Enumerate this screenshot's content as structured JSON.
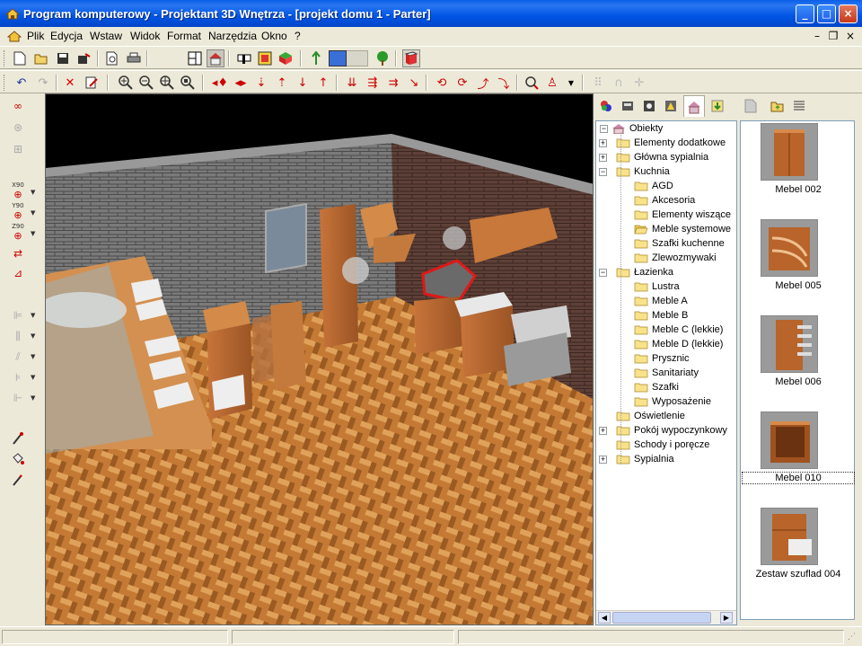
{
  "window": {
    "title": "Program komputerowy - Projektant 3D Wnętrza - [projekt domu 1 - Parter]",
    "controls": {
      "minimize": "_",
      "maximize": "□",
      "close": "×"
    }
  },
  "menu": {
    "items": [
      "Plik",
      "Edycja",
      "Wstaw",
      "Widok",
      "Format",
      "Narzędzia",
      "Okno",
      "?"
    ],
    "mdi_controls": [
      "–",
      "❐",
      "×"
    ]
  },
  "toolbar1": {
    "icons": [
      "new-icon",
      "open-icon",
      "save-icon",
      "save-as-icon",
      "print-preview-icon",
      "print-icon",
      "plan-view-icon",
      "3d-house-icon",
      "wall-view-icon",
      "object-view-icon",
      "3d-cube-icon",
      "arrow-icon",
      "color-swatch",
      "tree-icon",
      "book-icon"
    ],
    "color_swatch": "#3a6fd8"
  },
  "toolbar2": {
    "icons": [
      "undo-icon",
      "redo-icon",
      "delete-icon",
      "properties-icon",
      "zoom-in-icon",
      "zoom-out-icon",
      "zoom-all-icon",
      "zoom-fit-icon",
      "move-left-right-icon",
      "move-both-icon",
      "move-down-icon",
      "move-up-icon",
      "lower-icon",
      "raise-icon",
      "walk-icon",
      "walk-2-icon",
      "walk-3-icon",
      "walk-4-icon",
      "rotate-left-icon",
      "rotate-right-icon",
      "tilt-up-icon",
      "tilt-down-icon",
      "zoom-camera-icon",
      "camera-icon",
      "grid-icon",
      "magnet-icon",
      "snap-icon"
    ]
  },
  "left_toolbar": {
    "icons": [
      "link-icon",
      "rotate-icon",
      "group-icon",
      "rotate-x90-icon",
      "rotate-y90-icon",
      "rotate-z90-icon",
      "mirror-icon",
      "align-icon",
      "align-left-icon",
      "distribute-icon",
      "distribute-2-icon",
      "spacing-icon",
      "size-icon",
      "eyedropper-icon",
      "paint-bucket-icon",
      "pencil-icon"
    ],
    "rotate_labels": [
      "X90",
      "Y90",
      "Z90"
    ]
  },
  "tree": {
    "tabs": [
      "materials-tab",
      "furniture-tab",
      "objects-tab",
      "models-tab",
      "library-tab",
      "import-tab"
    ],
    "root": "Obiekty",
    "items": [
      {
        "label": "Elementy dodatkowe",
        "level": 1,
        "expander": "+"
      },
      {
        "label": "Główna sypialnia",
        "level": 1,
        "expander": "+"
      },
      {
        "label": "Kuchnia",
        "level": 1,
        "expander": "−"
      },
      {
        "label": "AGD",
        "level": 2
      },
      {
        "label": "Akcesoria",
        "level": 2
      },
      {
        "label": "Elementy wiszące",
        "level": 2
      },
      {
        "label": "Meble systemowe",
        "level": 2,
        "open": true
      },
      {
        "label": "Szafki kuchenne",
        "level": 2
      },
      {
        "label": "Zlewozmywaki",
        "level": 2
      },
      {
        "label": "Łazienka",
        "level": 1,
        "expander": "−"
      },
      {
        "label": "Lustra",
        "level": 2
      },
      {
        "label": "Meble A",
        "level": 2
      },
      {
        "label": "Meble B",
        "level": 2
      },
      {
        "label": "Meble C (lekkie)",
        "level": 2
      },
      {
        "label": "Meble D (lekkie)",
        "level": 2
      },
      {
        "label": "Prysznic",
        "level": 2
      },
      {
        "label": "Sanitariaty",
        "level": 2
      },
      {
        "label": "Szafki",
        "level": 2
      },
      {
        "label": "Wyposażenie",
        "level": 2
      },
      {
        "label": "Oświetlenie",
        "level": 1
      },
      {
        "label": "Pokój wypoczynkowy",
        "level": 1,
        "expander": "+"
      },
      {
        "label": "Schody i poręcze",
        "level": 1
      },
      {
        "label": "Sypialnia",
        "level": 1,
        "expander": "+"
      }
    ]
  },
  "gallery": {
    "tabs": [
      "page-tab",
      "up-folder-tab",
      "list-view-tab"
    ],
    "items": [
      {
        "label": "Mebel 002",
        "icon": "tall-cabinet-icon"
      },
      {
        "label": "Mebel 005",
        "icon": "corner-shelf-icon"
      },
      {
        "label": "Mebel 006",
        "icon": "drawer-unit-icon"
      },
      {
        "label": "Mebel 010",
        "icon": "open-cabinet-icon",
        "selected": true
      },
      {
        "label": "Zestaw szuflad 004",
        "icon": "drawer-set-icon"
      }
    ]
  },
  "colors": {
    "titlebar": "#0055e5",
    "wood": "#b8642a",
    "floor": "#c07a35",
    "brick_left": "#6e6e6e",
    "brick_right": "#5a4038",
    "selection": "#e01818"
  }
}
